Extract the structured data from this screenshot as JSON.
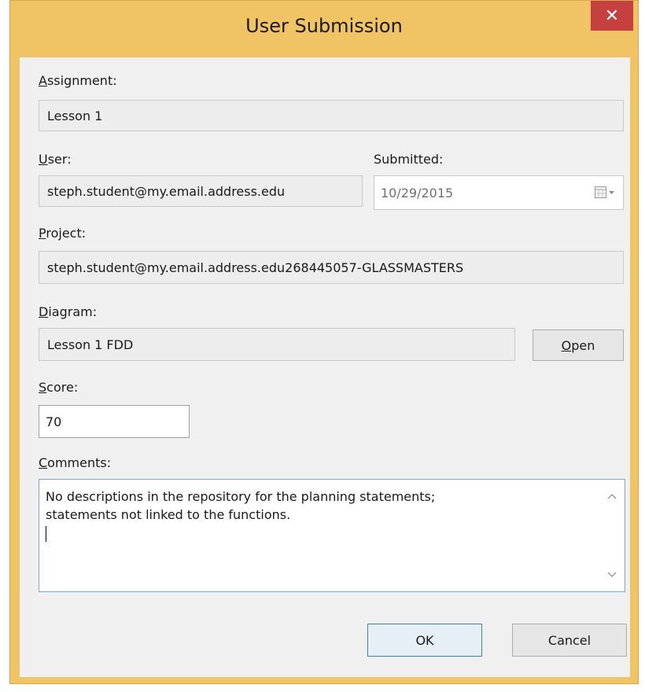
{
  "window": {
    "title": "User Submission",
    "close_glyph": "✕"
  },
  "fields": {
    "assignment": {
      "label_u": "A",
      "label_rest": "ssignment:",
      "value": "Lesson 1"
    },
    "user": {
      "label_u": "U",
      "label_rest": "ser:",
      "value": "steph.student@my.email.address.edu"
    },
    "submitted": {
      "label": "Submitted:",
      "value": "10/29/2015",
      "icon": "calendar-icon"
    },
    "project": {
      "label_u": "P",
      "label_rest": "roject:",
      "value": "steph.student@my.email.address.edu268445057-GLASSMASTERS"
    },
    "diagram": {
      "label_u": "D",
      "label_rest": "iagram:",
      "value": "Lesson 1 FDD"
    },
    "score": {
      "label_u": "S",
      "label_rest": "core:",
      "value": "70"
    },
    "comments": {
      "label_u": "C",
      "label_rest": "omments:",
      "line1": "No descriptions in the repository for the planning statements;",
      "line2": "statements not linked to the functions."
    }
  },
  "buttons": {
    "open_u": "O",
    "open_rest": "pen",
    "ok": "OK",
    "cancel": "Cancel"
  }
}
